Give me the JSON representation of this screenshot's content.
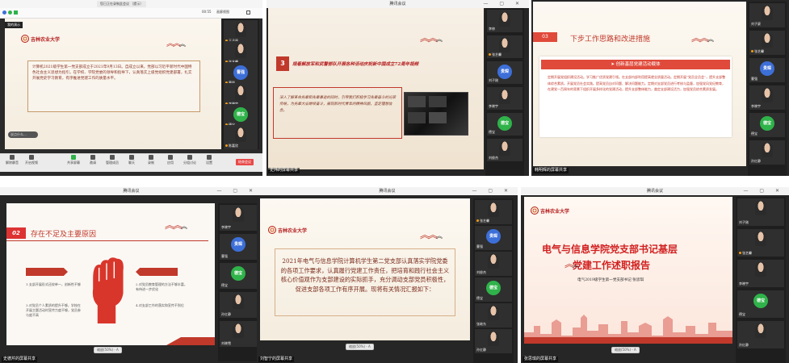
{
  "meeting_title": "腾讯会议",
  "panels": {
    "p1": {
      "topbar_label": "您已正在录制此会议 （提示）",
      "view_label": "画廊视图",
      "time_label": "00:55",
      "slide_tag": "我的演示",
      "slide_body": "计算机2021级学生第一党支部成立于2021年9月13日。自成立以来，党部以习近平新时代中国特色社会主义思想为指引，在学校、学院党委的领导和指导下，认真落实上级党组织党建部署，扎实开展党史学习教育，有序推进党建工作的质量水平。",
      "toolbar": [
        "解除静音",
        "开启视频",
        "共享屏幕",
        "邀请",
        "管理成员",
        "聊天",
        "录制",
        "应用",
        "分组讨论",
        "设置"
      ],
      "end_label": "结束会议",
      "tiles": [
        {
          "name": "王子豪",
          "type": "photo"
        },
        {
          "name": "张艺馨",
          "type": "photo"
        },
        {
          "name": "曹强",
          "type": "circle",
          "color": "#3d6fd8"
        },
        {
          "name": "李晓宇",
          "type": "photo"
        },
        {
          "name": "德宝",
          "type": "circle",
          "color": "#2fb34a"
        },
        {
          "name": "陈嘉欣",
          "type": "photo"
        }
      ]
    },
    "p2": {
      "num": "3",
      "heading": "观看解放军和武警部队开展各种活动庆祝新中国成立72周年视频",
      "box_text": "深入了解革命先辈和先辈事迹的同时，引导我们积极学习先辈奋斗的光荣传统，为先辈大业继续奋斗，展现新时代青年的精神风貌，坚定理想信念。",
      "share_label": "史炜的屏幕共享",
      "tiles": [
        {
          "name": "李修",
          "type": "photo"
        },
        {
          "name": "张艺馨",
          "type": "photo"
        },
        {
          "name": "刘子刚",
          "type": "circle",
          "color": "#3d6fd8"
        },
        {
          "name": "李晓宇",
          "type": "photo"
        },
        {
          "name": "德宝",
          "type": "circle",
          "color": "#2fb34a"
        },
        {
          "name": "刘俊杰",
          "type": "photo"
        }
      ]
    },
    "p3": {
      "num": "03",
      "heading": "下步工作思路和改进措施",
      "subheading": "➤ 创新基层党建活动载体",
      "body": "定期开展党组织建设活动。学习推广优质党建引领。在支部内部利用提高就业质量活动。定期开展“党员全员会”，提升支部整体综合素质。开展党员社会实践。提高党员自对问题、解决问题能力。定期对支部党员进行考核与监督，加强党风党纪教育，在建党一百周年的背景下组织开展多样化的党建活动，提升支部整体能力，奠定支部建设活力，加强党员综合素质发展。",
      "share_label": "韩明辉的屏幕共享",
      "tiles": [
        {
          "name": "刘子豪",
          "type": "photo"
        },
        {
          "name": "张艺馨",
          "type": "photo"
        },
        {
          "name": "曹强",
          "type": "circle",
          "color": "#3d6fd8"
        },
        {
          "name": "李晓宇",
          "type": "photo"
        },
        {
          "name": "德宝",
          "type": "circle",
          "color": "#2fb34a"
        },
        {
          "name": "孙红静",
          "type": "photo"
        }
      ]
    },
    "p4": {
      "num": "02",
      "heading": "存在不足及主要原因",
      "left_items": [
        "1.支部开展形式还较单一，创新性不够",
        "3.对党员个人素质的提升不够，学校在开展主题活动时宣传力度不够，党员参与度不高"
      ],
      "right_items": [
        "2.对党员教育管理的方法不够丰富，有待进一步优化",
        "4.对支部工作的落实和宣传不到位"
      ],
      "share_label": "史德芹的屏幕共享",
      "zoom": "缩放(50%) - A",
      "tiles": [
        {
          "name": "李晓宇",
          "type": "photo"
        },
        {
          "name": "曹强",
          "type": "circle",
          "color": "#3d6fd8"
        },
        {
          "name": "德宝",
          "type": "circle",
          "color": "#2fb34a"
        },
        {
          "name": "孙红静",
          "type": "photo"
        },
        {
          "name": "刘晓雪",
          "type": "photo"
        }
      ]
    },
    "p5": {
      "body": "2021年电气与信息学院计算机学生第二党支部认真落实学院党委的各项工作要求，认真履行党建工作责任，把培育和践行社会主义核心价值观作为支部建设的实际抓手，充分调动支部党员积极性，促进支部各项工作有序开展。现将有关情况汇报如下：",
      "share_label": "刘智宁的屏幕共享",
      "zoom": "缩放(50%) - A",
      "tiles": [
        {
          "name": "张艺馨",
          "type": "photo"
        },
        {
          "name": "曹强",
          "type": "circle",
          "color": "#3d6fd8"
        },
        {
          "name": "刘俊杰",
          "type": "photo"
        },
        {
          "name": "德宝",
          "type": "circle",
          "color": "#2fb34a"
        },
        {
          "name": "张继东",
          "type": "photo"
        },
        {
          "name": "孙红静",
          "type": "photo"
        }
      ]
    },
    "p6": {
      "title_line1": "电气与信息学院党支部书记基层",
      "title_line2": "党建工作述职报告",
      "subtitle": "电气2019级学生第一党支部书记  张思琪",
      "share_label": "张思琪的屏幕共享",
      "zoom": "缩放(50%) - A",
      "tiles": [
        {
          "name": "刘子刚",
          "type": "photo"
        },
        {
          "name": "张艺馨",
          "type": "photo"
        },
        {
          "name": "李晓宇",
          "type": "photo"
        },
        {
          "name": "德宝",
          "type": "circle",
          "color": "#2fb34a"
        },
        {
          "name": "孙红静",
          "type": "photo"
        }
      ]
    }
  },
  "school_name": "吉林农业大学",
  "colors": {
    "accent_red": "#c0392b",
    "blue": "#3d6fd8",
    "green": "#2fb34a"
  }
}
